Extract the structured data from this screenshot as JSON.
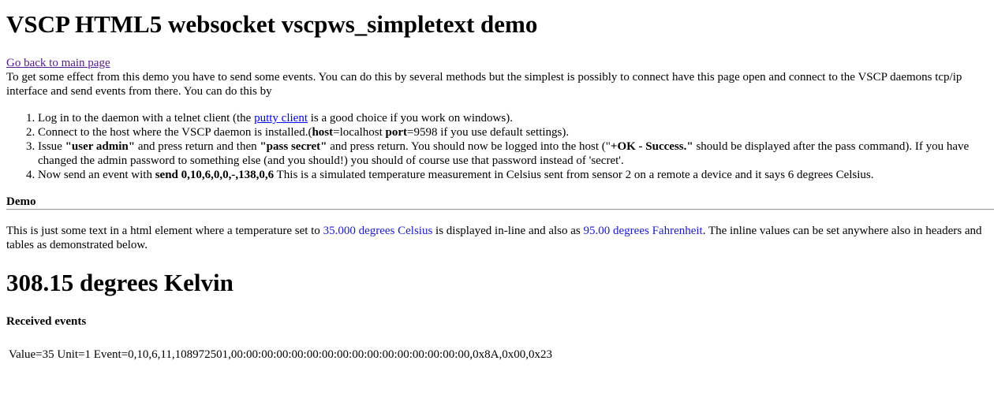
{
  "page": {
    "title": "VSCP HTML5 websocket vscpws_simpletext demo",
    "back_link": "Go back to main page",
    "intro": "To get some effect from this demo you have to send some events. You can do this by several methods but the simplest is possibly to connect have this page open and connect to the VSCP daemons tcp/ip interface and send events from there. You can do this by"
  },
  "steps": [
    {
      "before": "Log in to the daemon with a telnet client (the ",
      "link": "putty client",
      "after": " is a good choice if you work on windows)."
    },
    {
      "before": "Connect to the host where the VSCP daemon is installed.(",
      "host_label": "host",
      "host_value": "=localhost ",
      "port_label": "port",
      "port_value": "=9598 if you use default settings)."
    },
    {
      "t1": "Issue ",
      "b1": "\"user admin\"",
      "t2": " and press return and then ",
      "b2": "\"pass secret\"",
      "t3": " and press return. You should now be logged into the host (\"",
      "b3": "+OK - Success.\"",
      "t4": " should be displayed after the pass command). If you have changed the admin password to something else (and you should!) you should of course use that password instead of 'secret'."
    },
    {
      "t1": "Now send an event with ",
      "b1": "send 0,10,6,0,0,-,138,0,6",
      "t2": " This is a simulated temperature measurement in Celsius sent from sensor 2 on a remote a device and it says 6 degrees Celsius."
    }
  ],
  "demo": {
    "heading": "Demo",
    "text_before": "This is just some text in a html element where a temperature set to ",
    "celsius": "35.000 degrees Celsius",
    "text_middle": " is displayed in-line and also as ",
    "fahrenheit": "95.00 degrees Fahrenheit",
    "text_after": ". The inline values can be set anywhere also in headers and tables as demonstrated below.",
    "kelvin": "308.15 degrees Kelvin",
    "colors": {
      "temperature": "#1a1acc",
      "visited_link": "#551a8b",
      "link": "#0000ee"
    }
  },
  "received": {
    "heading": "Received events",
    "event": "Value=35 Unit=1 Event=0,10,6,11,108972501,00:00:00:00:00:00:00:00:00:00:00:00:00:00:00:00,0x8A,0x00,0x23"
  }
}
